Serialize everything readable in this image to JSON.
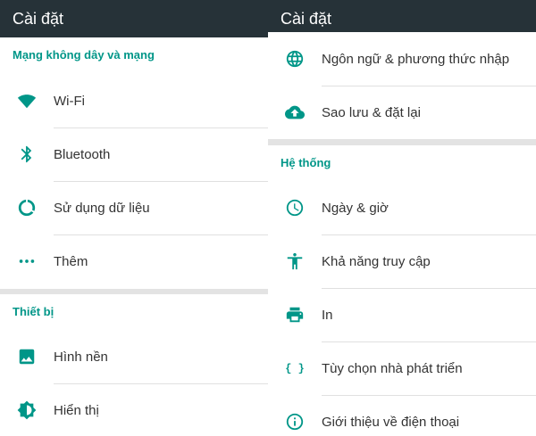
{
  "left": {
    "appbar_title": "Cài đặt",
    "section_wireless": {
      "title": "Mạng không dây và mạng",
      "items": [
        {
          "label": "Wi-Fi",
          "icon": "wifi-icon"
        },
        {
          "label": "Bluetooth",
          "icon": "bluetooth-icon"
        },
        {
          "label": "Sử dụng dữ liệu",
          "icon": "data-usage-icon"
        },
        {
          "label": "Thêm",
          "icon": "more-icon"
        }
      ]
    },
    "section_device": {
      "title": "Thiết bị",
      "items": [
        {
          "label": "Hình nền",
          "icon": "wallpaper-icon"
        },
        {
          "label": "Hiển thị",
          "icon": "brightness-icon"
        }
      ]
    }
  },
  "right": {
    "appbar_title": "Cài đặt",
    "section_personal": {
      "items": [
        {
          "label": "Ngôn ngữ & phương thức nhập",
          "icon": "globe-icon"
        },
        {
          "label": "Sao lưu & đặt lại",
          "icon": "cloud-upload-icon"
        }
      ]
    },
    "section_system": {
      "title": "Hệ thống",
      "items": [
        {
          "label": "Ngày & giờ",
          "icon": "clock-icon"
        },
        {
          "label": "Khả năng truy cập",
          "icon": "accessibility-icon"
        },
        {
          "label": "In",
          "icon": "printer-icon"
        },
        {
          "label": "Tùy chọn nhà phát triển",
          "icon": "code-braces-icon"
        },
        {
          "label": "Giới thiệu về điện thoại",
          "icon": "info-icon"
        }
      ]
    }
  },
  "colors": {
    "appbar": "#263238",
    "accent": "#009688",
    "divider": "#e0e0e0",
    "background": "#e3e3e3"
  }
}
